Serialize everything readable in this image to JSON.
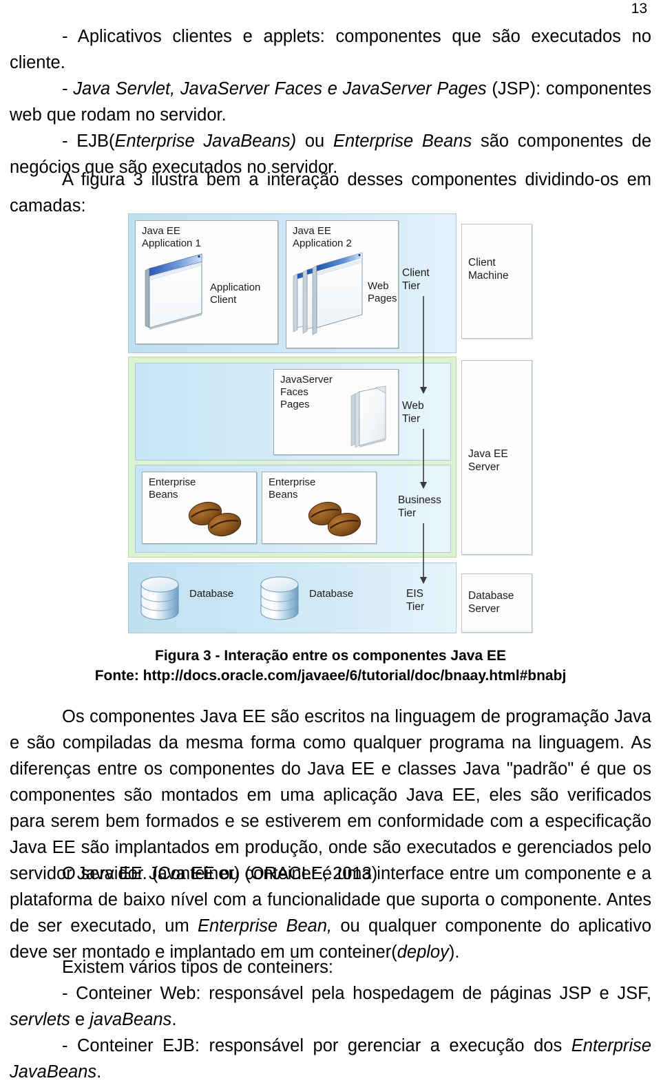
{
  "page": {
    "number": "13"
  },
  "paragraphs": {
    "bullet_client": "- Aplicativos clientes e applets: componentes que são executados no cliente.",
    "bullet_web_a": "- ",
    "bullet_web_it": "Java Servlet, JavaServer Faces e JavaServer Pages",
    "bullet_web_b": " (JSP): componentes web que rodam no servidor.",
    "bullet_ejb_a": "- EJB(",
    "bullet_ejb_it1": "Enterprise JavaBeans)",
    "bullet_ejb_b": " ou ",
    "bullet_ejb_it2": "Enterprise Beans",
    "bullet_ejb_c": " são componentes de negócios que são executados no servidor.",
    "fig_intro": "A figura 3 ilustra bem a interação desses componentes dividindo-os em camadas:",
    "para_components": "Os componentes Java EE são escritos na linguagem de programação Java e são compiladas da mesma forma como qualquer programa na linguagem. As diferenças entre os componentes do Java EE e classes Java \"padrão\" é que os componentes são montados em uma aplicação Java EE, eles são verificados para serem bem formados e se estiverem em conformidade com a especificação Java EE são implantados em produção, onde são executados e gerenciados pelo servidor Java EE. (Conteiner) (ORACLE, 2013)",
    "para_server_a": "O servidor Java EE ou conteiner é uma interface entre um componente e a plataforma de baixo nível com a funcionalidade que suporta o componente. Antes de ser executado, um ",
    "para_server_it1": "Enterprise Bean,",
    "para_server_b": " ou qualquer componente do aplicativo deve ser montado e implantado em um conteiner(",
    "para_server_it2": "deploy",
    "para_server_c": ").",
    "para_types": "Existem vários tipos de conteiners:",
    "bullet_web_container_a": "- Conteiner Web: responsável pela hospedagem de páginas JSP e JSF, ",
    "bullet_web_container_it1": "servlets",
    "bullet_web_container_b": " e ",
    "bullet_web_container_it2": "javaBeans",
    "bullet_web_container_c": ".",
    "bullet_ejb_container_a": "- Conteiner EJB: responsável por gerenciar a execução dos ",
    "bullet_ejb_container_it": "Enterprise JavaBeans",
    "bullet_ejb_container_b": "."
  },
  "figure": {
    "caption_line1": "Figura 3 - Interação entre os componentes Java EE",
    "caption_line2": "Fonte: http://docs.oracle.com/javaee/6/tutorial/doc/bnaay.html#bnabj",
    "components": {
      "app1_title": "Java EE\nApplication 1",
      "app1_label": "Application\nClient",
      "app2_title": "Java EE\nApplication 2",
      "app2_label": "Web\nPages",
      "jsf_label": "JavaServer\nFaces\nPages",
      "eb1_label": "Enterprise\nBeans",
      "eb2_label": "Enterprise\nBeans",
      "db1_label": "Database",
      "db2_label": "Database"
    },
    "tiers": {
      "client": "Client\nTier",
      "web": "Web\nTier",
      "business": "Business\nTier",
      "eis": "EIS\nTier"
    },
    "machines": {
      "client_machine": "Client\nMachine",
      "javaee_server": "Java EE\nServer",
      "database_server": "Database\nServer"
    },
    "colors": {
      "client_band": "#cfe8f6",
      "server_band": "#ddf2d0",
      "eis_band": "#d2eaf7",
      "bean_brown": "#8a5a26"
    }
  }
}
